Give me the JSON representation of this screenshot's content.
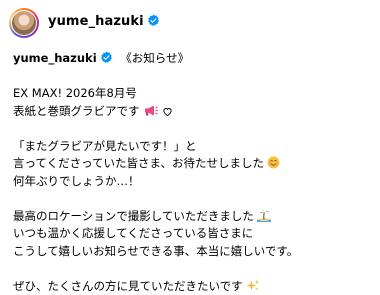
{
  "header": {
    "username": "yume_hazuki",
    "avatar_icon": "profile-photo",
    "verified_icon": "verified-badge-icon"
  },
  "caption": {
    "username": "yume_hazuki",
    "title": "《お知らせ》",
    "lines": [
      "EX MAX! 2026年8月号",
      "表紙と巻頭グラビアです",
      "「またグラビアが見たいです！」と",
      "言ってくださっていた皆さま、お待たせしました",
      "何年ぶりでしょうか…！",
      "最高のロケーションで撮影していただきました",
      "いつも温かく応援してくださっている皆さまに",
      "こうして嬉しいお知らせできる事、本当に嬉しいです。",
      "ぜひ、たくさんの方に見ていただきたいです"
    ],
    "emoji_icons": [
      "megaphone-icon",
      "heart-outline-icon",
      "smiling-face-icon",
      "palm-tree-island-icon",
      "sparkles-icon"
    ]
  },
  "colors": {
    "verified": "#0095f6",
    "text": "#000000",
    "background": "#ffffff"
  }
}
